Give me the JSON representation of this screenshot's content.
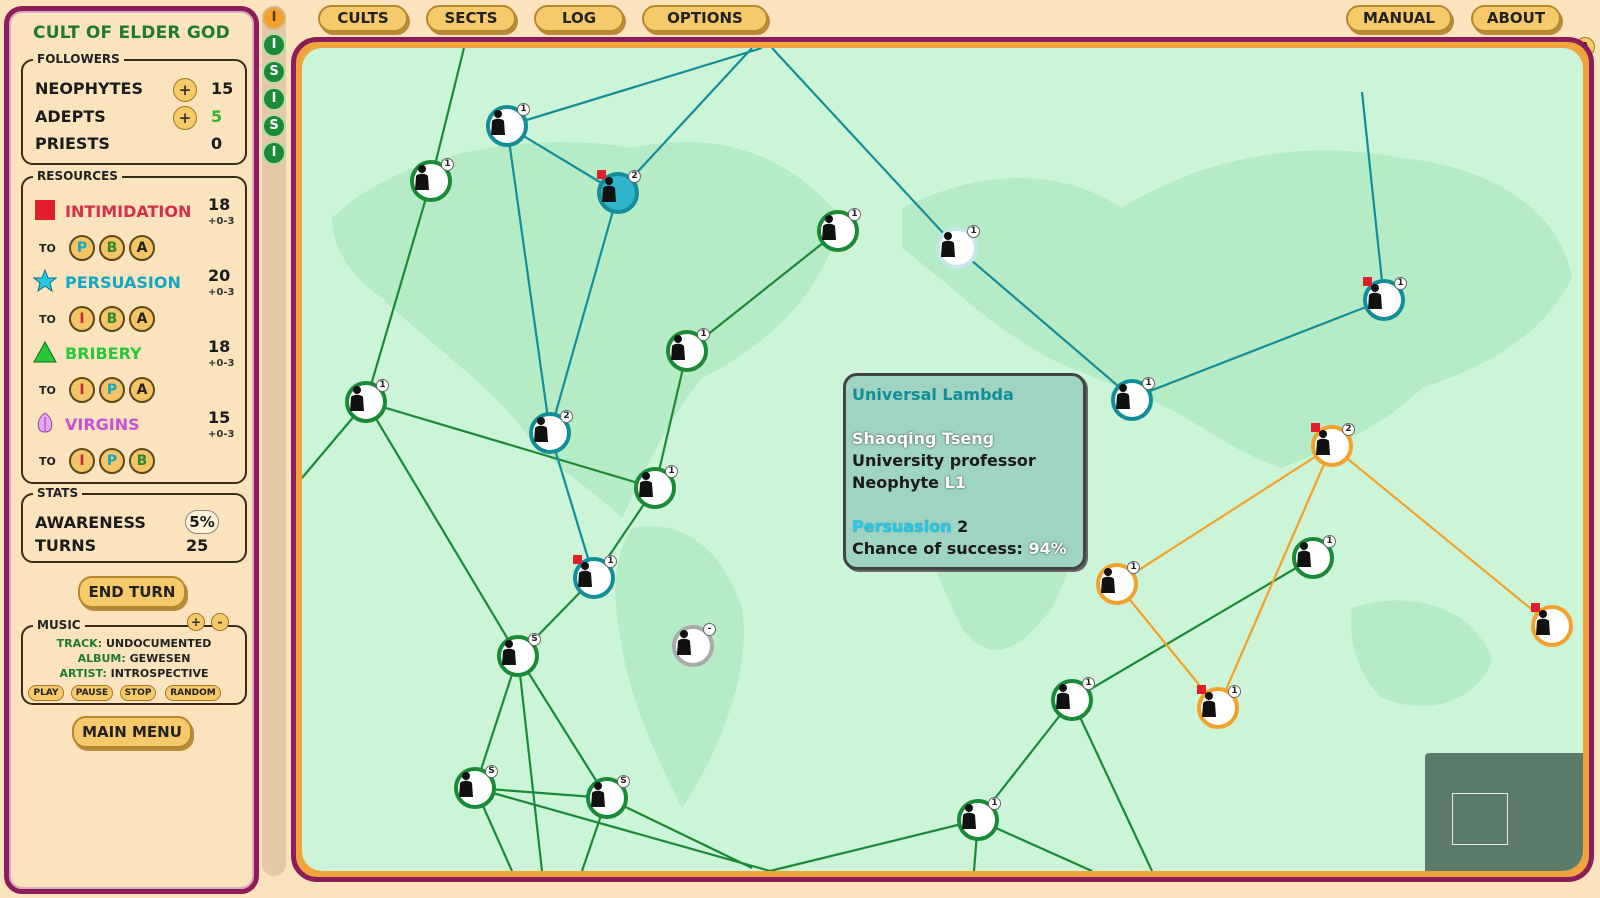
{
  "game": {
    "cult_name": "CULT OF ELDER GOD"
  },
  "followers": {
    "label": "FOLLOWERS",
    "rows": [
      {
        "name": "NEOPHYTES",
        "value": "15",
        "plus": "+"
      },
      {
        "name": "ADEPTS",
        "value": "5",
        "plus": "+"
      },
      {
        "name": "PRIESTS",
        "value": "0"
      }
    ]
  },
  "resources": {
    "label": "RESOURCES",
    "to_label": "TO",
    "items": [
      {
        "name": "INTIMIDATION",
        "value": "18",
        "inc": "+0-3",
        "color": "#d4304a",
        "targets": [
          "P",
          "B",
          "A"
        ]
      },
      {
        "name": "PERSUASION",
        "value": "20",
        "inc": "+0-3",
        "color": "#12a7c4",
        "targets": [
          "I",
          "B",
          "A"
        ]
      },
      {
        "name": "BRIBERY",
        "value": "18",
        "inc": "+0-3",
        "color": "#2bc73a",
        "targets": [
          "I",
          "P",
          "A"
        ]
      },
      {
        "name": "VIRGINS",
        "value": "15",
        "inc": "+0-3",
        "color": "#c84fd6",
        "targets": [
          "I",
          "P",
          "B"
        ]
      }
    ]
  },
  "stats": {
    "label": "STATS",
    "awareness_label": "AWARENESS",
    "awareness_value": "5%",
    "turns_label": "TURNS",
    "turns_value": "25"
  },
  "end_turn_label": "END TURN",
  "music": {
    "label": "MUSIC",
    "vol_up": "+",
    "vol_down": "-",
    "track_key": "TRACK:",
    "track": "UNDOCUMENTED",
    "album_key": "ALBUM:",
    "album": "GEWESEN",
    "artist_key": "ARTIST:",
    "artist": "INTROSPECTIVE",
    "buttons": [
      "PLAY",
      "PAUSE",
      "STOP",
      "RANDOM"
    ]
  },
  "main_menu_label": "MAIN MENU",
  "sects": [
    "I",
    "I",
    "S",
    "I",
    "S",
    "I"
  ],
  "topbar": {
    "left": [
      "CULTS",
      "SECTS",
      "LOG",
      "OPTIONS"
    ],
    "right": [
      "MANUAL",
      "ABOUT"
    ],
    "corner": "A"
  },
  "tooltip": {
    "cult": "Universal Lambda",
    "person": "Shaoqing Tseng",
    "job": "University professor",
    "rank": "Neophyte",
    "rank_level": "L1",
    "resource": "Persuasion",
    "resource_cost": "2",
    "chance_label": "Chance of success:",
    "chance_value": "94%"
  },
  "colors": {
    "frame": "#8c1d5a",
    "map": "#ccf5d8",
    "green_link": "#1a8a36",
    "teal_link": "#138e99",
    "orange_link": "#f2a12a"
  }
}
